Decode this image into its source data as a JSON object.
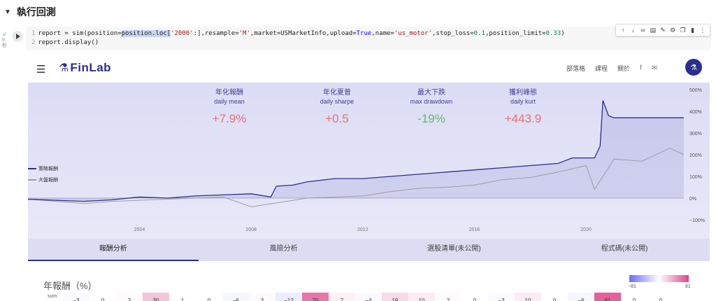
{
  "section": {
    "title": "執行回測"
  },
  "gutter": {
    "status": "✓",
    "time": "9\n秒"
  },
  "code": {
    "line1_number": "1",
    "line2_number": "2",
    "line1_a": "report = sim(position=",
    "line1_hl": "position.loc[",
    "line1_s1": "'2000'",
    "line1_b": ":],resample=",
    "line1_s2": "'M'",
    "line1_c": ",market=USMarketInfo,upload=",
    "line1_kw": "True",
    "line1_d": ",name=",
    "line1_s3": "'us_motor'",
    "line1_e": ",stop_loss=",
    "line1_n1": "0.1",
    "line1_f": ",position_limit=",
    "line1_n2": "0.33",
    "line1_g": ")",
    "line2": "report.display()"
  },
  "toolbar": {
    "icons": [
      "arrow-up-icon",
      "arrow-down-icon",
      "link-icon",
      "comment-icon",
      "edit-icon",
      "gear-icon",
      "copy-icon",
      "trash-icon",
      "more-icon"
    ]
  },
  "nav": {
    "brand": "FinLab",
    "links": [
      "部落格",
      "課程",
      "關於"
    ],
    "social": [
      "f",
      "✉"
    ]
  },
  "stats": [
    {
      "zh": "年化報酬",
      "en": "daily mean",
      "value": "+7.9%",
      "color": "#e57373"
    },
    {
      "zh": "年化夏普",
      "en": "daily sharpe",
      "value": "+0.5",
      "color": "#e57373"
    },
    {
      "zh": "最大下跌",
      "en": "max drawdown",
      "value": "-19%",
      "color": "#66bb6a"
    },
    {
      "zh": "獲利峰態",
      "en": "daily kurt",
      "value": "+443.9",
      "color": "#e57373"
    }
  ],
  "legend": [
    {
      "name": "策略報酬",
      "color": "#2b2f8e"
    },
    {
      "name": "大盤報酬",
      "color": "#9e9e9e"
    }
  ],
  "chart_data": {
    "type": "line",
    "x_ticks": [
      "2004",
      "2008",
      "2012",
      "2016",
      "2020"
    ],
    "y_ticks": [
      "500%",
      "400%",
      "300%",
      "200%",
      "100%",
      "0%",
      "−100%"
    ],
    "ylim": [
      -100,
      500
    ],
    "xlim": [
      2000,
      2023.5
    ],
    "series": [
      {
        "name": "策略報酬",
        "color": "#2b2f8e",
        "x": [
          2000,
          2001,
          2002,
          2003,
          2004,
          2005,
          2006,
          2007,
          2008,
          2008.7,
          2008.9,
          2009.5,
          2010,
          2011,
          2012,
          2013,
          2014,
          2015,
          2016,
          2017,
          2018,
          2019,
          2019.5,
          2020.3,
          2020.5,
          2020.6,
          2020.8,
          2021,
          2022,
          2023.5
        ],
        "y": [
          -5,
          -10,
          -15,
          -8,
          5,
          0,
          10,
          15,
          20,
          5,
          55,
          60,
          75,
          90,
          90,
          100,
          110,
          120,
          130,
          140,
          150,
          160,
          185,
          185,
          240,
          450,
          380,
          370,
          370,
          370
        ]
      },
      {
        "name": "大盤報酬",
        "color": "#9e9e9e",
        "x": [
          2000,
          2001,
          2002,
          2003,
          2004,
          2005,
          2006,
          2007,
          2008,
          2009,
          2010,
          2011,
          2012,
          2013,
          2014,
          2015,
          2016,
          2017,
          2018,
          2019,
          2020,
          2020.3,
          2021,
          2022,
          2023,
          2023.5
        ],
        "y": [
          -5,
          -15,
          -25,
          -15,
          -10,
          -5,
          0,
          5,
          -40,
          -20,
          0,
          5,
          10,
          30,
          45,
          50,
          60,
          85,
          95,
          120,
          150,
          40,
          180,
          170,
          230,
          200
        ]
      }
    ]
  },
  "tabs": [
    "報酬分析",
    "風險分析",
    "選股清單(未公開)",
    "程式碼(未公開)"
  ],
  "annual": {
    "title": "年報酬（%）",
    "min_label": "−81",
    "max_label": "81",
    "row_label": "sum",
    "values": [
      -3,
      0,
      2,
      30,
      1,
      0,
      -6,
      3,
      -12,
      70,
      7,
      -4,
      19,
      10,
      2,
      0,
      -3,
      10,
      0,
      -6,
      81,
      0,
      0
    ]
  }
}
